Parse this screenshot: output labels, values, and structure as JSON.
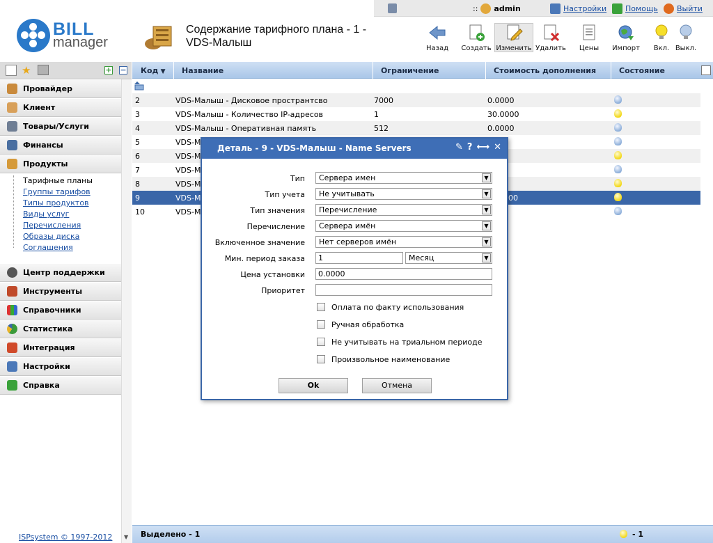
{
  "topbar": {
    "separator": "::",
    "user": "admin",
    "links": [
      {
        "label": "Настройки",
        "icon": "settings-icon"
      },
      {
        "label": "Помощь",
        "icon": "help-icon"
      },
      {
        "label": "Выйти",
        "icon": "logout-icon"
      }
    ]
  },
  "logo": {
    "line1": "BILL",
    "line2": "manager"
  },
  "header": {
    "title": "Содержание тарифного плана - 1 - VDS-Малыш"
  },
  "toolbar": [
    {
      "label": "Назад",
      "icon": "back-arrow-icon"
    },
    {
      "label": "Создать",
      "icon": "create-icon"
    },
    {
      "label": "Изменить",
      "icon": "edit-icon"
    },
    {
      "label": "Удалить",
      "icon": "delete-icon"
    },
    {
      "label": "Цены",
      "icon": "prices-icon"
    },
    {
      "label": "Импорт",
      "icon": "import-icon"
    },
    {
      "label": "Вкл.",
      "icon": "enable-bulb-icon"
    },
    {
      "label": "Выкл.",
      "icon": "disable-bulb-icon"
    }
  ],
  "sidebar": {
    "menus_top": [
      "Провайдер",
      "Клиент",
      "Товары/Услуги",
      "Финансы",
      "Продукты"
    ],
    "products_sub": [
      "Тарифные планы",
      "Группы тарифов",
      "Типы продуктов",
      "Виды услуг",
      "Перечисления",
      "Образы диска",
      "Соглашения"
    ],
    "menus_bottom": [
      "Центр поддержки",
      "Инструменты",
      "Справочники",
      "Статистика",
      "Интеграция",
      "Настройки",
      "Справка"
    ],
    "copyright": "ISPsystem © 1997-2012"
  },
  "table": {
    "headers": [
      "Код",
      "Название",
      "Ограничение",
      "Стоимость дополнения",
      "Состояние"
    ],
    "rows": [
      {
        "id": "2",
        "name": "VDS-Малыш - Дисковое пространтсво",
        "limit": "7000",
        "cost": "0.0000",
        "on": false
      },
      {
        "id": "3",
        "name": "VDS-Малыш - Количество IP-адресов",
        "limit": "1",
        "cost": "30.0000",
        "on": true
      },
      {
        "id": "4",
        "name": "VDS-Малыш - Оперативная память",
        "limit": "512",
        "cost": "0.0000",
        "on": false
      },
      {
        "id": "5",
        "name": "VDS-Ma",
        "limit": "",
        "cost": "",
        "on": false
      },
      {
        "id": "6",
        "name": "VDS-M",
        "limit": "",
        "cost": "",
        "on": true
      },
      {
        "id": "7",
        "name": "VDS-M",
        "limit": "",
        "cost": "",
        "on": false
      },
      {
        "id": "8",
        "name": "VDS-M",
        "limit": "",
        "cost": "",
        "on": true
      },
      {
        "id": "9",
        "name": "VDS-M",
        "limit": "",
        "cost": "00",
        "on": true
      },
      {
        "id": "10",
        "name": "VDS-M",
        "limit": "",
        "cost": "",
        "on": false
      }
    ],
    "footer_selected": "Выделено - 1",
    "footer_count": "- 1"
  },
  "dialog": {
    "title": "Деталь - 9 - VDS-Малыш - Name Servers",
    "fields": {
      "type": {
        "label": "Тип",
        "value": "Сервера имен"
      },
      "accounting": {
        "label": "Тип учета",
        "value": "Не учитывать"
      },
      "value_type": {
        "label": "Тип значения",
        "value": "Перечисление"
      },
      "enumeration": {
        "label": "Перечисление",
        "value": "Сервера имён"
      },
      "included": {
        "label": "Включенное значение",
        "value": "Нет серверов имён"
      },
      "min_period": {
        "label": "Мин. период заказа",
        "value": "1",
        "unit": "Месяц"
      },
      "setup_price": {
        "label": "Цена установки",
        "value": "0.0000"
      },
      "priority": {
        "label": "Приоритет",
        "value": ""
      }
    },
    "checkboxes": [
      "Оплата по факту использования",
      "Ручная обработка",
      "Не учитывать на триальном периоде",
      "Произвольное наименование"
    ],
    "ok": "Ok",
    "cancel": "Отмена"
  }
}
